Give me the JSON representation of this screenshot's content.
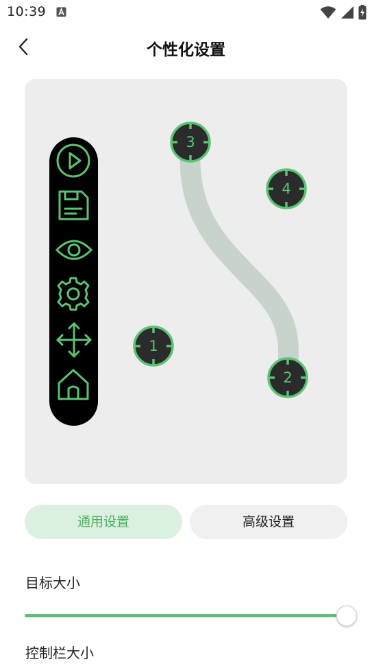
{
  "status_bar": {
    "time": "10:39",
    "notification_icon": "a-app-icon",
    "wifi_icon": "wifi-icon",
    "signal_icon": "cell-signal-icon",
    "battery_icon": "battery-charging-icon"
  },
  "header": {
    "title": "个性化设置",
    "back_icon": "chevron-left-icon"
  },
  "preview": {
    "toolbar_icons": [
      "play-icon",
      "save-icon",
      "eye-icon",
      "gear-icon",
      "move-arrows-icon",
      "home-icon"
    ],
    "targets": [
      {
        "label": "1"
      },
      {
        "label": "2"
      },
      {
        "label": "3"
      },
      {
        "label": "4"
      }
    ],
    "accent_color": "#5bc374",
    "path_color": "#c8d4cb"
  },
  "tabs": [
    {
      "label": "通用设置",
      "active": true
    },
    {
      "label": "高级设置",
      "active": false
    }
  ],
  "settings": {
    "target_size_label": "目标大小",
    "target_size_value": 1.0,
    "control_bar_size_label": "控制栏大小"
  }
}
